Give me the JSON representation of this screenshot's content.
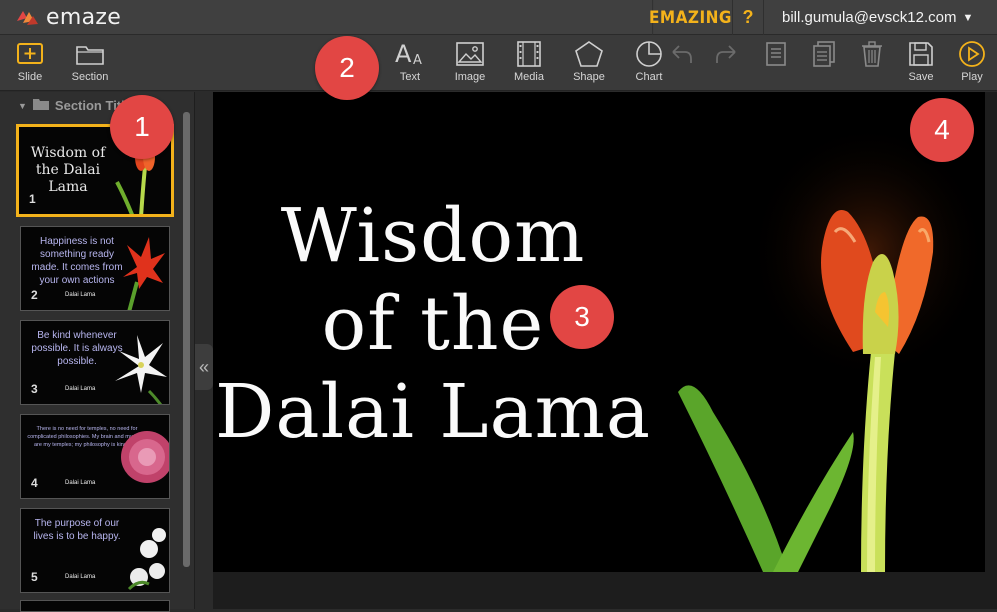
{
  "app": {
    "name": "emaze",
    "emazing_label": "EMAZING",
    "help_label": "?",
    "account": "bill.gumula@evsck12.com"
  },
  "toolbar": {
    "slide_label": "Slide",
    "section_label": "Section",
    "text_label": "Text",
    "image_label": "Image",
    "media_label": "Media",
    "shape_label": "Shape",
    "chart_label": "Chart",
    "save_label": "Save",
    "play_label": "Play"
  },
  "sidebar": {
    "section_title": "Section Title",
    "slides": [
      {
        "num": "1",
        "text": "Wisdom of the Dalai Lama",
        "author": ""
      },
      {
        "num": "2",
        "text": "Happiness is not something ready made. It comes from your own actions",
        "author": "Dalai Lama"
      },
      {
        "num": "3",
        "text": "Be kind whenever possible. It is always possible.",
        "author": "Dalai Lama"
      },
      {
        "num": "4",
        "text": "There is no need for temples, no need for complicated philosophies. My brain and my heart are my temples; my philosophy is kindness.",
        "author": "Dalai Lama"
      },
      {
        "num": "5",
        "text": "The purpose of our lives is to be happy.",
        "author": "Dalai Lama"
      }
    ]
  },
  "slide": {
    "title_line1": "Wisdom",
    "title_line2": "of the",
    "title_line3": "Dalai Lama"
  },
  "markers": [
    "1",
    "2",
    "3",
    "4"
  ],
  "colors": {
    "accent": "#f3b21b",
    "marker": "#e24644",
    "topbar": "#404040"
  }
}
